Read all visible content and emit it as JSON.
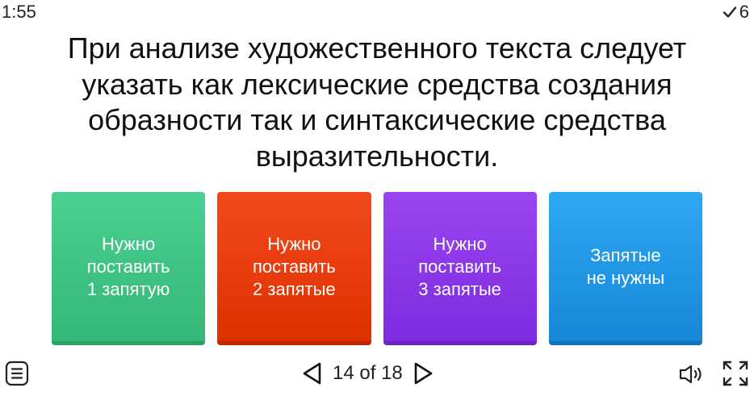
{
  "status": {
    "timer": "1:55",
    "score": "6"
  },
  "question": {
    "text": "При анализе художественного текста следует указать как лексические средства создания образности так и синтаксические средства выразительности."
  },
  "answers": [
    {
      "label": "Нужно\nпоставить\n1 запятую",
      "color": "#3cc283"
    },
    {
      "label": "Нужно\nпоставить\n2 запятые",
      "color": "#e83c0d"
    },
    {
      "label": "Нужно\nпоставить\n3 запятые",
      "color": "#8a37e8"
    },
    {
      "label": "Запятые\nне нужны",
      "color": "#2096e4"
    }
  ],
  "footer": {
    "page_current": "14",
    "page_of": "of",
    "page_total": "18",
    "icons": [
      "menu-icon",
      "prev-arrow-icon",
      "next-arrow-icon",
      "speaker-icon",
      "fullscreen-icon"
    ]
  }
}
